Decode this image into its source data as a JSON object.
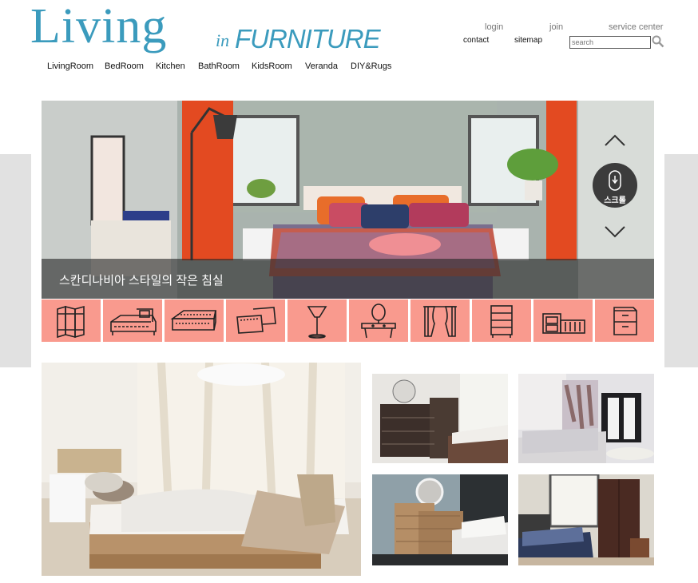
{
  "logo": {
    "main": "Living",
    "in": "in",
    "sub": "FURNITURE"
  },
  "top_links": {
    "login": "login",
    "join": "join",
    "service": "service center",
    "contact": "contact",
    "sitemap": "sitemap"
  },
  "search": {
    "placeholder": "search"
  },
  "nav": [
    "LivingRoom",
    "BedRoom",
    "Kitchen",
    "BathRoom",
    "KidsRoom",
    "Veranda",
    "DIY&Rugs"
  ],
  "hero": {
    "caption": "스칸디나비아 스타일의 작은 침실",
    "scroll_label": "스크롤"
  },
  "categories": [
    "screen-icon",
    "bed-icon",
    "mattress-icon",
    "pillow-icon",
    "lamp-icon",
    "dresser-mirror-icon",
    "curtain-icon",
    "drawer-chest-icon",
    "shelf-icon",
    "cabinet-icon"
  ],
  "colors": {
    "brand": "#3b9bbd",
    "category_bg": "#f99a8e",
    "side_panel": "#e1e1e1"
  }
}
